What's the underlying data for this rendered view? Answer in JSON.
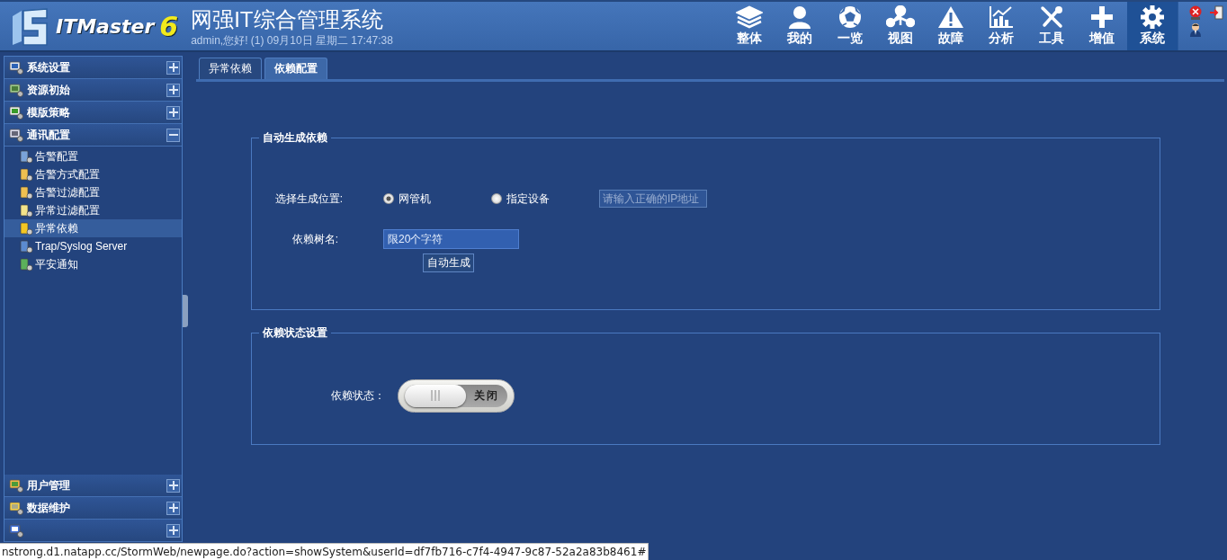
{
  "header": {
    "product": "ITMaster",
    "version": "6",
    "title": "网强IT综合管理系统",
    "greeting": "admin,您好! (1) 09月10日 星期二 17:47:38"
  },
  "nav": [
    {
      "label": "整体",
      "selected": false
    },
    {
      "label": "我的",
      "selected": false
    },
    {
      "label": "一览",
      "selected": false
    },
    {
      "label": "视图",
      "selected": false
    },
    {
      "label": "故障",
      "selected": false
    },
    {
      "label": "分析",
      "selected": false
    },
    {
      "label": "工具",
      "selected": false
    },
    {
      "label": "增值",
      "selected": false
    },
    {
      "label": "系统",
      "selected": true
    }
  ],
  "sidebar": {
    "groups": [
      {
        "label": "系统设置",
        "expanded": false
      },
      {
        "label": "资源初始",
        "expanded": false
      },
      {
        "label": "模版策略",
        "expanded": false
      },
      {
        "label": "通讯配置",
        "expanded": true,
        "children": [
          {
            "label": "告警配置",
            "selected": false
          },
          {
            "label": "告警方式配置",
            "selected": false
          },
          {
            "label": "告警过滤配置",
            "selected": false
          },
          {
            "label": "异常过滤配置",
            "selected": false
          },
          {
            "label": "异常依赖",
            "selected": true
          },
          {
            "label": "Trap/Syslog Server",
            "selected": false
          },
          {
            "label": "平安通知",
            "selected": false
          }
        ]
      },
      {
        "label": "用户管理",
        "expanded": false
      },
      {
        "label": "数据维护",
        "expanded": false
      },
      {
        "expanded": false
      }
    ]
  },
  "tabs": [
    {
      "label": "异常依赖",
      "selected": false
    },
    {
      "label": "依赖配置",
      "selected": true
    }
  ],
  "auto_generate": {
    "legend": "自动生成依赖",
    "location_label": "选择生成位置:",
    "location_options": [
      {
        "label": "网管机",
        "selected": true
      },
      {
        "label": "指定设备",
        "selected": false
      }
    ],
    "ip_field": {
      "placeholder": "请输入正确的IP地址",
      "disabled": true
    },
    "tree_name_label": "依赖树名:",
    "tree_name_field": {
      "placeholder": "限20个字符"
    },
    "generate_button": "自动生成"
  },
  "status_settings": {
    "legend": "依赖状态设置",
    "status_label": "依赖状态：",
    "toggle": {
      "on": false,
      "label": "关闭"
    }
  },
  "status_bar": {
    "url": "nstrong.d1.natapp.cc/StormWeb/newpage.do?action=showSystem&userId=df7fb716-c7f4-4947-9c87-52a2a83b8461#"
  }
}
